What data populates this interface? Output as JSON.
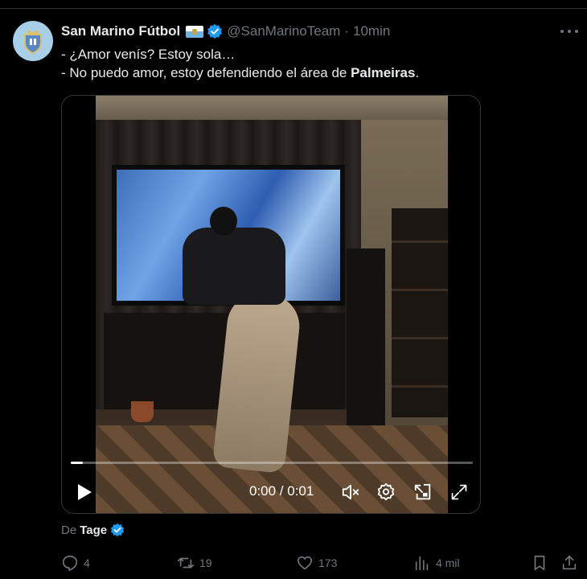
{
  "account": {
    "display_name": "San Marino Fútbol",
    "handle": "@SanMarinoTeam",
    "separator": "·",
    "time_ago": "10min"
  },
  "tweet": {
    "line1": "- ¿Amor venís? Estoy sola…",
    "line2_prefix": "- No puedo amor, estoy defendiendo el área de ",
    "line2_bold": "Palmeiras",
    "line2_suffix": "."
  },
  "video": {
    "time_display": "0:00 / 0:01",
    "progress": 0.03
  },
  "source": {
    "prefix": "De",
    "name": "Tage"
  },
  "actions": {
    "replies": "4",
    "reposts": "19",
    "likes": "173",
    "views": "4 mil"
  },
  "colors": {
    "background": "#000000",
    "text": "#e7e9ea",
    "muted": "#71767b",
    "verified": "#1d9bf0",
    "border": "#333639"
  },
  "icons": [
    "verified-badge-icon",
    "more-options-icon",
    "play-icon",
    "mute-icon",
    "settings-icon",
    "pip-icon",
    "fullscreen-icon",
    "reply-icon",
    "repost-icon",
    "like-icon",
    "views-icon",
    "bookmark-icon",
    "share-icon"
  ]
}
